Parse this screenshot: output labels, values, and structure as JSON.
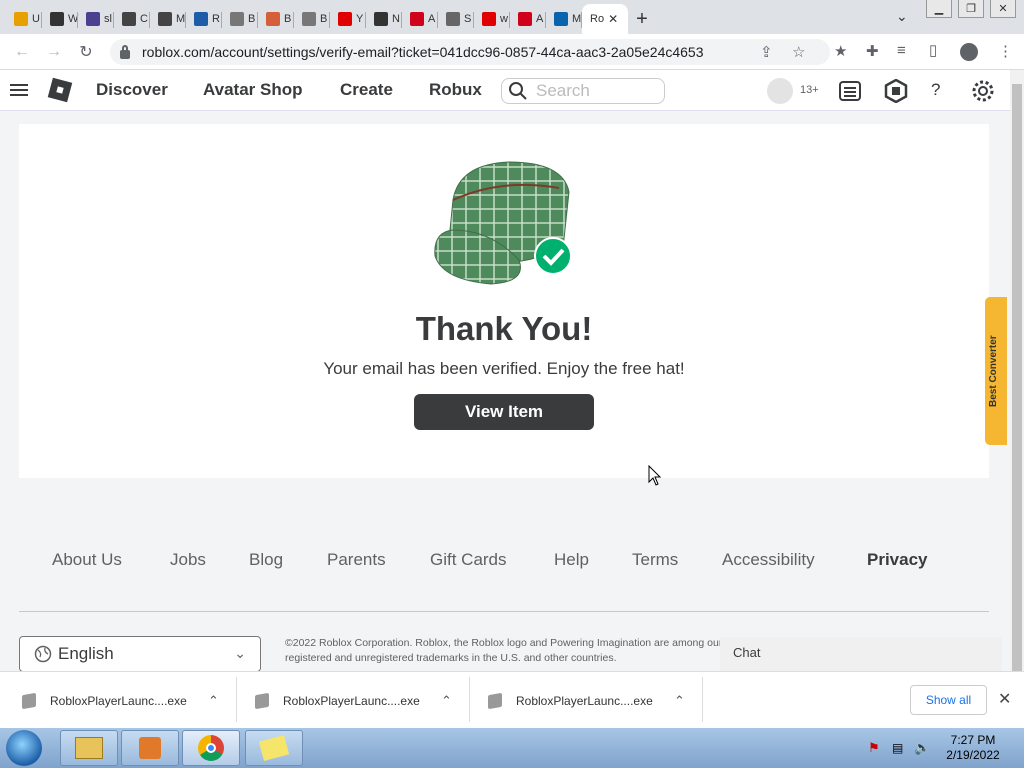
{
  "browser": {
    "tabs": [
      {
        "label": "U",
        "icon": "ud-icon",
        "color": "#e8a000"
      },
      {
        "label": "W",
        "icon": "film-icon",
        "color": "#333333"
      },
      {
        "label": "sl",
        "icon": "sl-icon",
        "color": "#4b3f8f"
      },
      {
        "label": "C",
        "icon": "c-icon",
        "color": "#444444"
      },
      {
        "label": "M",
        "icon": "roblox-icon",
        "color": "#444444"
      },
      {
        "label": "R",
        "icon": "r-icon",
        "color": "#1e5ca8"
      },
      {
        "label": "B",
        "icon": "doc-icon",
        "color": "#777777"
      },
      {
        "label": "B",
        "icon": "b-icon",
        "color": "#d45f3a"
      },
      {
        "label": "B",
        "icon": "doc-icon",
        "color": "#777777"
      },
      {
        "label": "Y",
        "icon": "youtube-icon",
        "color": "#e00000"
      },
      {
        "label": "N",
        "icon": "github-icon",
        "color": "#333333"
      },
      {
        "label": "A",
        "icon": "ask-icon",
        "color": "#d0011b"
      },
      {
        "label": "S",
        "icon": "s-icon",
        "color": "#666666"
      },
      {
        "label": "w",
        "icon": "youtube-icon",
        "color": "#e00000"
      },
      {
        "label": "A",
        "icon": "ask-icon",
        "color": "#d0011b"
      },
      {
        "label": "M",
        "icon": "outlook-icon",
        "color": "#0a64ad"
      }
    ],
    "active_tab": {
      "label": "Ro",
      "close": "✕"
    },
    "new_tab": "+",
    "url": "roblox.com/account/settings/verify-email?ticket=041dcc96-0857-44ca-aac3-2a05e24c4653"
  },
  "header": {
    "nav": [
      "Discover",
      "Avatar Shop",
      "Create",
      "Robux"
    ],
    "search_placeholder": "Search",
    "age_badge": "13+",
    "help": "?"
  },
  "main": {
    "title": "Thank You!",
    "message": "Your email has been verified. Enjoy the free hat!",
    "button": "View Item"
  },
  "extension": {
    "label": "Best Converter"
  },
  "footer": {
    "links": [
      "About Us",
      "Jobs",
      "Blog",
      "Parents",
      "Gift Cards",
      "Help",
      "Terms",
      "Accessibility",
      "Privacy"
    ],
    "language": "English",
    "copyright": "©2022 Roblox Corporation. Roblox, the Roblox logo and Powering Imagination are among our registered and unregistered trademarks in the U.S. and other countries."
  },
  "chat": {
    "label": "Chat"
  },
  "downloads": {
    "items": [
      "RobloxPlayerLaunc....exe",
      "RobloxPlayerLaunc....exe",
      "RobloxPlayerLaunc....exe"
    ],
    "show_all": "Show all"
  },
  "taskbar": {
    "time": "7:27 PM",
    "date": "2/19/2022"
  }
}
